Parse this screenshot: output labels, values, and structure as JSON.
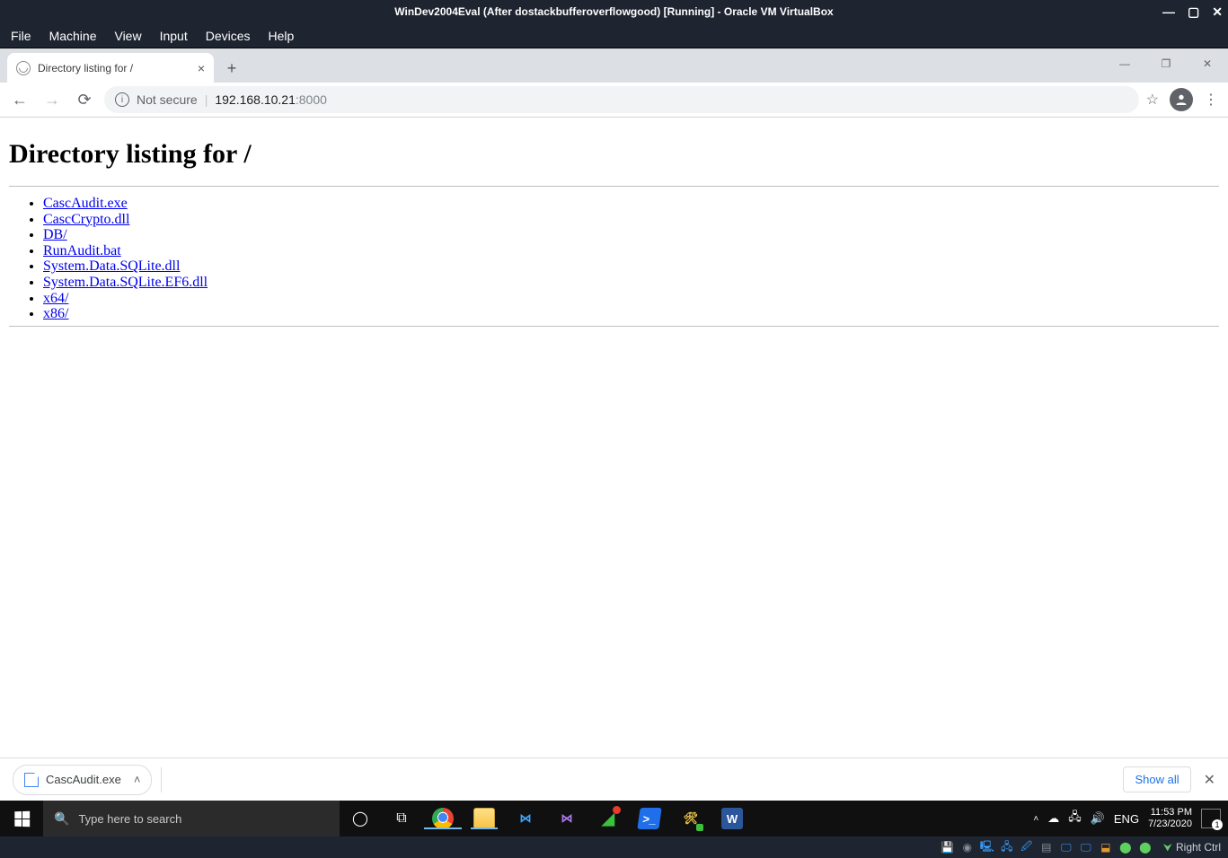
{
  "vbox": {
    "title": "WinDev2004Eval (After dostackbufferoverflowgood) [Running] - Oracle VM VirtualBox",
    "menu": [
      "File",
      "Machine",
      "View",
      "Input",
      "Devices",
      "Help"
    ],
    "hostkey": "Right Ctrl"
  },
  "browser": {
    "tab_title": "Directory listing for /",
    "not_secure": "Not secure",
    "url_host": "192.168.10.21",
    "url_port": ":8000"
  },
  "page": {
    "heading": "Directory listing for /",
    "files": [
      "CascAudit.exe",
      "CascCrypto.dll",
      "DB/",
      "RunAudit.bat",
      "System.Data.SQLite.dll",
      "System.Data.SQLite.EF6.dll",
      "x64/",
      "x86/"
    ]
  },
  "download": {
    "filename": "CascAudit.exe",
    "show_all": "Show all"
  },
  "taskbar": {
    "search_placeholder": "Type here to search",
    "lang": "ENG",
    "time": "11:53 PM",
    "date": "7/23/2020"
  }
}
